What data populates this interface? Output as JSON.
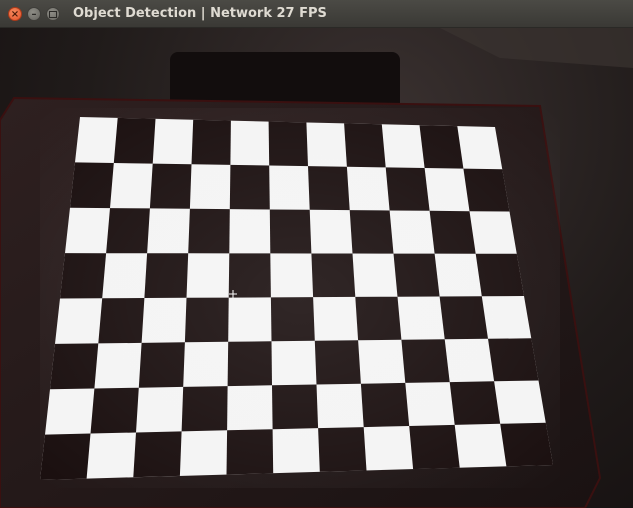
{
  "window": {
    "title": "Object Detection | Network 27 FPS",
    "controls": {
      "close_icon": "close-icon",
      "minimize_icon": "minimize-icon",
      "maximize_icon": "maximize-icon"
    }
  },
  "camera_view": {
    "content": "checkerboard-calibration-target",
    "rows": 8,
    "columns": 11,
    "colors": {
      "dark_square": "#1a0f0f",
      "light_square": "#f4f4f4",
      "tablet_body": "#2a1c1c",
      "background": "#201b1a"
    }
  }
}
